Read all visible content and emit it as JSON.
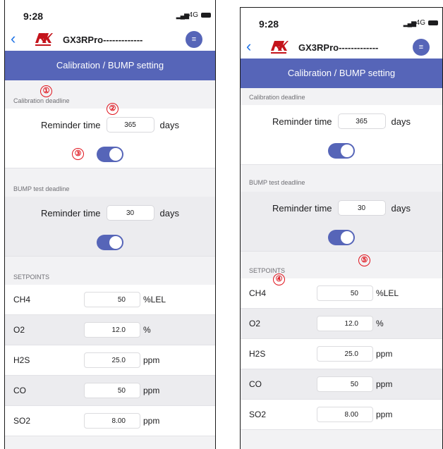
{
  "status": {
    "time": "9:28",
    "network": "4G"
  },
  "nav": {
    "device_name": "GX3RPro-------------",
    "menu_glyph": "≡"
  },
  "title": "Calibration / BUMP setting",
  "calibration": {
    "header": "Calibration deadline",
    "label": "Reminder time",
    "value": "365",
    "unit": "days",
    "enabled": true
  },
  "bump": {
    "header": "BUMP test deadline",
    "label": "Reminder time",
    "value": "30",
    "unit": "days",
    "enabled": true
  },
  "setpoints": {
    "header": "SETPOINTS",
    "items": [
      {
        "name": "CH4",
        "value": "50",
        "unit": "%LEL"
      },
      {
        "name": "O2",
        "value": "12.0",
        "unit": "%"
      },
      {
        "name": "H2S",
        "value": "25.0",
        "unit": "ppm"
      },
      {
        "name": "CO",
        "value": "50",
        "unit": "ppm"
      },
      {
        "name": "SO2",
        "value": "8.00",
        "unit": "ppm"
      }
    ]
  },
  "markers": [
    "①",
    "②",
    "③",
    "④",
    "⑤"
  ],
  "colors": {
    "accent": "#5665b8",
    "back": "#1f73e6",
    "marker": "#e0141d",
    "logo": "#c4141c"
  }
}
